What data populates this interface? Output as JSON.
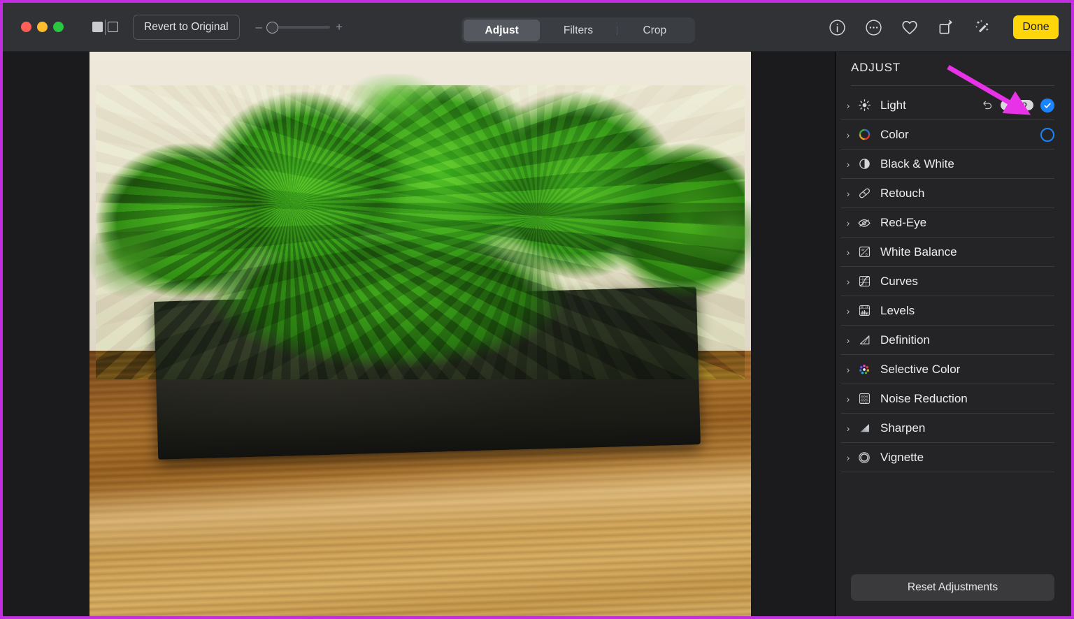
{
  "window": {
    "traffic_lights": [
      "close",
      "minimize",
      "zoom"
    ],
    "colors": {
      "close": "#ff5f57",
      "minimize": "#febc2e",
      "zoom": "#28c840"
    }
  },
  "toolbar": {
    "compare_icon": "split-view-icon",
    "revert_label": "Revert to Original",
    "zoom_minus": "–",
    "zoom_plus": "+",
    "zoom_value": 0,
    "tabs": [
      {
        "label": "Adjust",
        "active": true
      },
      {
        "label": "Filters",
        "active": false
      },
      {
        "label": "Crop",
        "active": false
      }
    ],
    "right_icons": [
      {
        "name": "info-icon"
      },
      {
        "name": "more-options-icon"
      },
      {
        "name": "heart-icon"
      },
      {
        "name": "rotate-icon"
      },
      {
        "name": "auto-enhance-icon"
      }
    ],
    "done_label": "Done",
    "done_color": "#ffd60a"
  },
  "panel": {
    "title": "ADJUST",
    "reset_label": "Reset Adjustments",
    "accent_color": "#1a84ff",
    "rows": [
      {
        "label": "Light",
        "icon": "sun-icon",
        "chevron": "›",
        "has_undo": true,
        "auto_label": "AUTO",
        "toggle": "on"
      },
      {
        "label": "Color",
        "icon": "color-wheel-icon",
        "chevron": "›",
        "has_undo": false,
        "auto_label": "",
        "toggle": "off"
      },
      {
        "label": "Black & White",
        "icon": "half-circle-icon",
        "chevron": "›",
        "has_undo": false,
        "auto_label": "",
        "toggle": "none"
      },
      {
        "label": "Retouch",
        "icon": "bandage-icon",
        "chevron": "›",
        "has_undo": false,
        "auto_label": "",
        "toggle": "none"
      },
      {
        "label": "Red-Eye",
        "icon": "eye-slash-icon",
        "chevron": "›",
        "has_undo": false,
        "auto_label": "",
        "toggle": "none"
      },
      {
        "label": "White Balance",
        "icon": "white-balance-icon",
        "chevron": "›",
        "has_undo": false,
        "auto_label": "",
        "toggle": "none"
      },
      {
        "label": "Curves",
        "icon": "curves-icon",
        "chevron": "›",
        "has_undo": false,
        "auto_label": "",
        "toggle": "none"
      },
      {
        "label": "Levels",
        "icon": "levels-icon",
        "chevron": "›",
        "has_undo": false,
        "auto_label": "",
        "toggle": "none"
      },
      {
        "label": "Definition",
        "icon": "definition-icon",
        "chevron": "›",
        "has_undo": false,
        "auto_label": "",
        "toggle": "none"
      },
      {
        "label": "Selective Color",
        "icon": "selective-color-icon",
        "chevron": "›",
        "has_undo": false,
        "auto_label": "",
        "toggle": "none"
      },
      {
        "label": "Noise Reduction",
        "icon": "noise-reduction-icon",
        "chevron": "›",
        "has_undo": false,
        "auto_label": "",
        "toggle": "none"
      },
      {
        "label": "Sharpen",
        "icon": "sharpen-icon",
        "chevron": "›",
        "has_undo": false,
        "auto_label": "",
        "toggle": "none"
      },
      {
        "label": "Vignette",
        "icon": "vignette-icon",
        "chevron": "›",
        "has_undo": false,
        "auto_label": "",
        "toggle": "none"
      }
    ]
  },
  "photo": {
    "subject": "green reindeer moss in a dark rectangular pot on a wooden table"
  },
  "annotation": {
    "arrow_color": "#e832e8",
    "border_color": "#c02ee0",
    "points_at": "AUTO"
  }
}
